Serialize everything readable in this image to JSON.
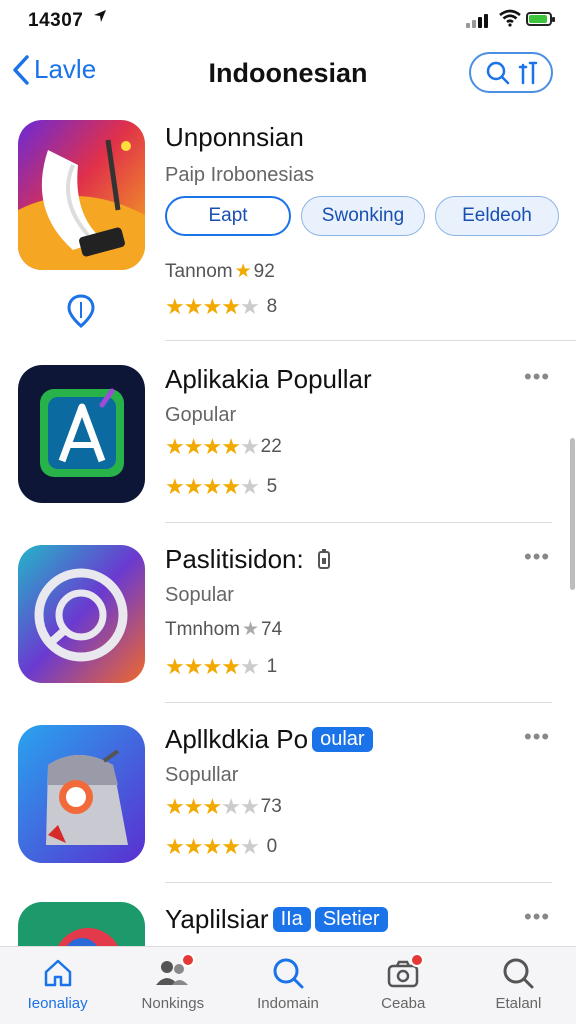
{
  "status_bar": {
    "time": "14307"
  },
  "nav": {
    "back_label": "Lavle",
    "title": "Indoonesian"
  },
  "apps": [
    {
      "title": "Unponnsian",
      "subtitle": "Paip Irobonesias",
      "buttons": [
        "Eapt",
        "Swonking",
        "Eeldeoh"
      ],
      "meta_text": "Tannom",
      "meta_value": "92",
      "rating_stars": 4,
      "rating_count": "8"
    },
    {
      "title": "Aplikakia Popullar",
      "subtitle": "Gopular",
      "meta_rating_stars": 4,
      "meta_value": "22",
      "rating_stars": 4,
      "rating_count": "5"
    },
    {
      "title": "Paslitisidon:",
      "subtitle": "Sopular",
      "meta_text": "Tmnhom",
      "meta_value": "74",
      "rating_stars": 4,
      "rating_count": "1"
    },
    {
      "title": "Apllkdkia Po",
      "badge": "oular",
      "subtitle": "Sopullar",
      "meta_rating_stars": 3,
      "meta_value": "73",
      "rating_stars": 4,
      "rating_count": "0"
    },
    {
      "title": "Yaplilsiar",
      "badge": "IIa",
      "badge2": "Sletier"
    }
  ],
  "tabs": [
    {
      "label": "Ieonaliay",
      "icon": "home-icon",
      "active": true
    },
    {
      "label": "Nonkings",
      "icon": "people-icon"
    },
    {
      "label": "Indomain",
      "icon": "search-icon"
    },
    {
      "label": "Ceaba",
      "icon": "camera-icon"
    },
    {
      "label": "Etalanl",
      "icon": "search-icon"
    }
  ],
  "colors": {
    "accent": "#1a73e8",
    "star": "#f2a900",
    "badge_dot": "#e53935"
  }
}
